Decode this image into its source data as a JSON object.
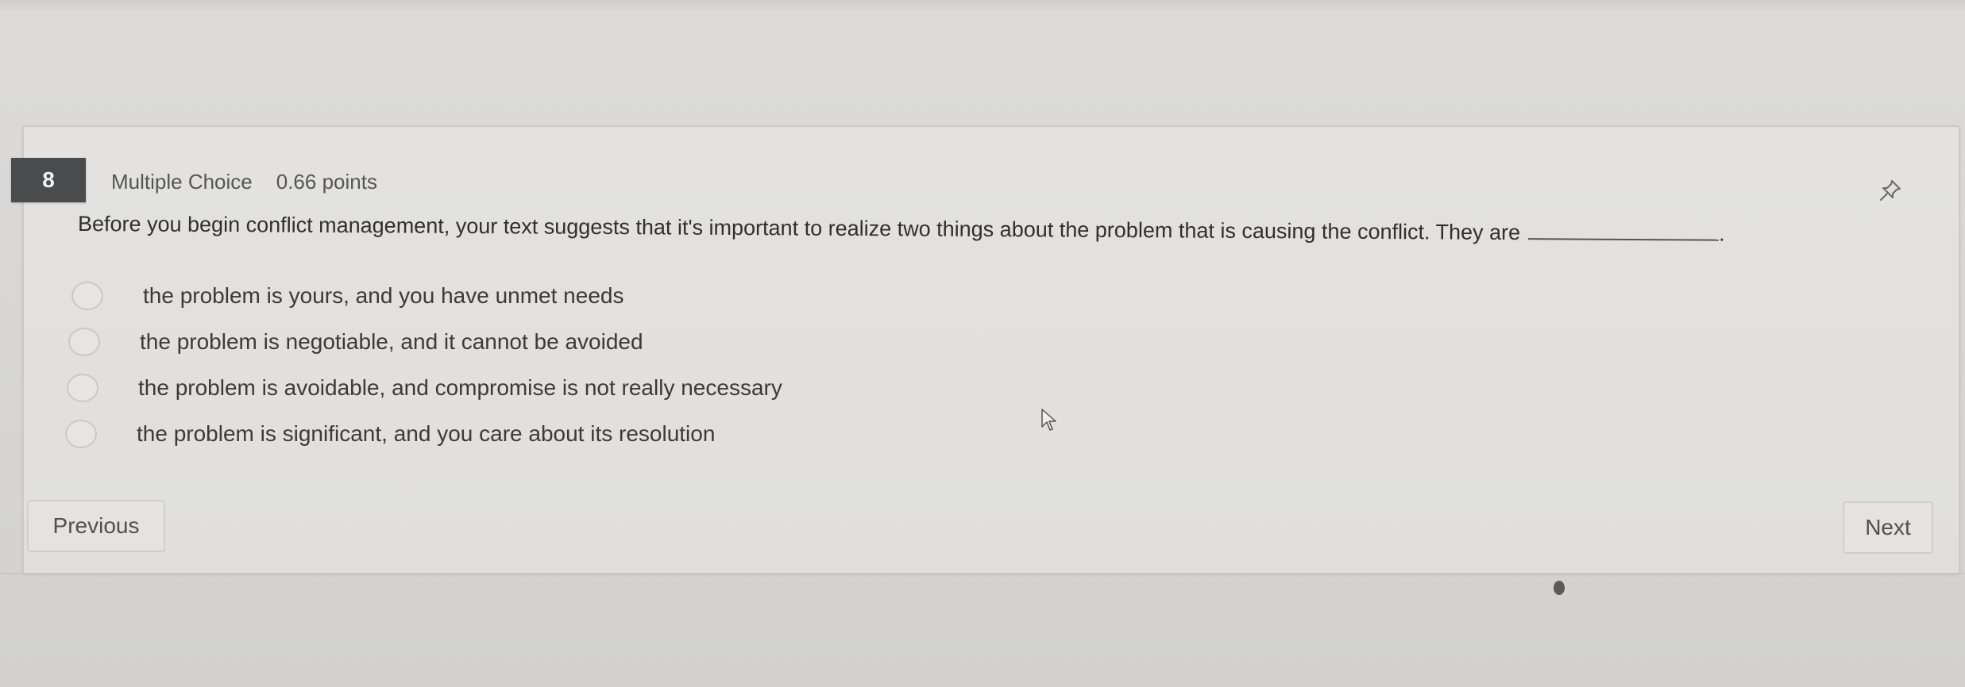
{
  "question": {
    "number": "8",
    "type": "Multiple Choice",
    "points": "0.66 points",
    "text": "Before you begin conflict management, your text suggests that it's important to realize two things about the problem that is causing the conflict. They are",
    "text_end": "."
  },
  "options": [
    {
      "label": "the problem is yours, and you have unmet needs"
    },
    {
      "label": "the problem is negotiable, and it cannot be avoided"
    },
    {
      "label": "the problem is avoidable, and compromise is not really necessary"
    },
    {
      "label": "the problem is significant, and you care about its resolution"
    }
  ],
  "navigation": {
    "previous_label": "Previous",
    "next_label": "Next"
  },
  "icons": {
    "pin": "pin-icon",
    "cursor": "mouse-cursor-icon"
  }
}
